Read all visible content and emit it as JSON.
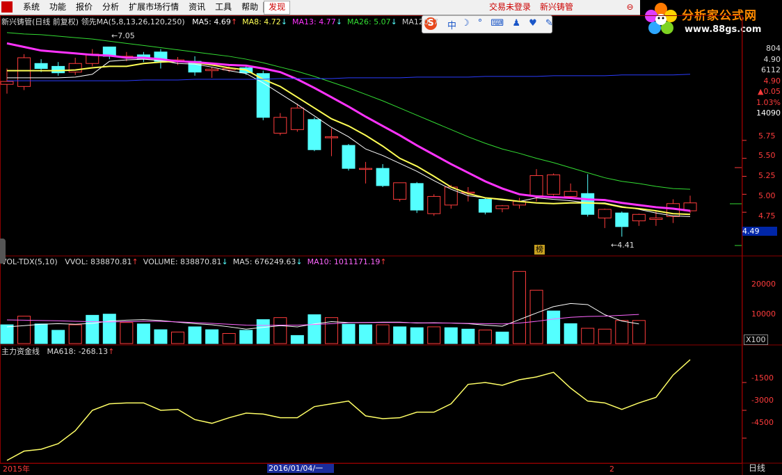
{
  "menu": {
    "items": [
      "系统",
      "功能",
      "报价",
      "分析",
      "扩展市场行情",
      "资讯",
      "工具",
      "帮助"
    ],
    "discover": "发现",
    "login_status": "交易未登录",
    "stock_name": "新兴铸管",
    "window_control": "⊖"
  },
  "brand": {
    "title": "分析家公式网",
    "url": "www.88gs.com"
  },
  "ime": {
    "logo": "S",
    "mode": "中"
  },
  "colors": {
    "up": "#ff3c3c",
    "down": "#54ffff",
    "ma5": "#ffffff",
    "ma8": "#ffff55",
    "ma13": "#ff33ff",
    "ma26": "#33dd33",
    "ma120": "#2b3cff",
    "grid": "#8b0000",
    "zhuli": "#ffff66"
  },
  "main_panel": {
    "title": "新兴铸管(日线 前复权) 领先MA(5,8,13,26,120,250)",
    "ma_items": [
      {
        "label": "MA5: 4.69",
        "arrow": "↑",
        "color": "#ffffff",
        "arrow_color": "#ff3c3c"
      },
      {
        "label": "MA8: 4.72",
        "arrow": "↓",
        "color": "#ffff55",
        "arrow_color": "#54ffff"
      },
      {
        "label": "MA13: 4.77",
        "arrow": "↓",
        "color": "#ff33ff",
        "arrow_color": "#54ffff"
      },
      {
        "label": "MA26: 5.07",
        "arrow": "↓",
        "color": "#33dd33",
        "arrow_color": "#54ffff"
      },
      {
        "label": "MA120: 7",
        "arrow": "",
        "color": "#cccccc",
        "arrow_color": "#cccccc"
      }
    ],
    "high_label": "7.05",
    "low_label": "4.41",
    "bang_badge": "榜",
    "right_info": [
      "804",
      "4.90",
      "6112",
      "4.90",
      "▲0.05",
      "1.03%",
      "14090"
    ],
    "price_ticks": [
      "5.75",
      "5.50",
      "5.25",
      "5.00",
      "4.75"
    ],
    "current_price": "4.49"
  },
  "volume_panel": {
    "title": "VOL-TDX(5,10)",
    "items": [
      {
        "label": "VVOL: 838870.81",
        "arrow": "↑",
        "color": "#dddddd",
        "arrow_color": "#ff3c3c"
      },
      {
        "label": "VOLUME: 838870.81",
        "arrow": "↓",
        "color": "#dddddd",
        "arrow_color": "#54ffff"
      },
      {
        "label": "MA5: 676249.63",
        "arrow": "↓",
        "color": "#dddddd",
        "arrow_color": "#54ffff"
      },
      {
        "label": "MA10: 1011171.19",
        "arrow": "↑",
        "color": "#ff66ff",
        "arrow_color": "#ff3c3c"
      }
    ],
    "ticks": [
      "20000",
      "10000"
    ],
    "unit": "X100"
  },
  "zhuli_panel": {
    "title": "主力资金线",
    "items": [
      {
        "label": "MA618: -268.13",
        "arrow": "↑",
        "color": "#dddddd",
        "arrow_color": "#ff3c3c"
      }
    ],
    "ticks": [
      "-1500",
      "-3000",
      "-4500"
    ]
  },
  "bottom_axis": {
    "year_label": "2015年",
    "cursor_date": "2016/01/04/一",
    "month_mark": "2",
    "period": "日线"
  },
  "chart_data": [
    {
      "type": "candlestick",
      "title": "新兴铸管(日线 前复权)",
      "ylim": [
        4.2,
        7.2
      ],
      "y_ticks": [
        4.75,
        5.0,
        5.25,
        5.5,
        5.75
      ],
      "candles": [
        {
          "o": 6.53,
          "c": 6.57,
          "h": 6.75,
          "l": 6.4
        },
        {
          "o": 6.5,
          "c": 6.9,
          "h": 6.95,
          "l": 6.45
        },
        {
          "o": 6.82,
          "c": 6.75,
          "h": 6.88,
          "l": 6.7
        },
        {
          "o": 6.78,
          "c": 6.69,
          "h": 6.84,
          "l": 6.65
        },
        {
          "o": 6.7,
          "c": 6.82,
          "h": 6.9,
          "l": 6.66
        },
        {
          "o": 6.82,
          "c": 6.95,
          "h": 7.02,
          "l": 6.78
        },
        {
          "o": 7.05,
          "c": 6.92,
          "h": 7.05,
          "l": 6.88
        },
        {
          "o": 6.92,
          "c": 6.92,
          "h": 6.98,
          "l": 6.85
        },
        {
          "o": 6.94,
          "c": 6.88,
          "h": 6.98,
          "l": 6.84
        },
        {
          "o": 6.98,
          "c": 6.85,
          "h": 7.02,
          "l": 6.75
        },
        {
          "o": 6.87,
          "c": 6.87,
          "h": 6.91,
          "l": 6.8
        },
        {
          "o": 6.85,
          "c": 6.7,
          "h": 6.92,
          "l": 6.65
        },
        {
          "o": 6.72,
          "c": 6.74,
          "h": 6.77,
          "l": 6.62
        },
        {
          "o": 6.73,
          "c": 6.75,
          "h": 6.78,
          "l": 6.7
        },
        {
          "o": 6.76,
          "c": 6.69,
          "h": 6.8,
          "l": 6.66
        },
        {
          "o": 6.68,
          "c": 6.07,
          "h": 6.72,
          "l": 6.03
        },
        {
          "o": 5.85,
          "c": 6.07,
          "h": 6.13,
          "l": 5.82
        },
        {
          "o": 5.9,
          "c": 6.2,
          "h": 6.26,
          "l": 5.87
        },
        {
          "o": 6.04,
          "c": 5.62,
          "h": 6.07,
          "l": 5.6
        },
        {
          "o": 5.8,
          "c": 5.8,
          "h": 5.92,
          "l": 5.53
        },
        {
          "o": 5.68,
          "c": 5.36,
          "h": 5.7,
          "l": 5.33
        },
        {
          "o": 5.36,
          "c": 5.36,
          "h": 5.45,
          "l": 5.15
        },
        {
          "o": 5.36,
          "c": 5.12,
          "h": 5.42,
          "l": 5.1
        },
        {
          "o": 4.93,
          "c": 5.16,
          "h": 5.16,
          "l": 4.9
        },
        {
          "o": 5.15,
          "c": 4.78,
          "h": 5.17,
          "l": 4.74
        },
        {
          "o": 4.73,
          "c": 4.97,
          "h": 5.0,
          "l": 4.7
        },
        {
          "o": 4.85,
          "c": 5.1,
          "h": 5.13,
          "l": 4.8
        },
        {
          "o": 5.03,
          "c": 5.03,
          "h": 5.1,
          "l": 4.9
        },
        {
          "o": 4.93,
          "c": 4.75,
          "h": 4.95,
          "l": 4.72
        },
        {
          "o": 4.8,
          "c": 4.84,
          "h": 4.85,
          "l": 4.75
        },
        {
          "o": 4.85,
          "c": 4.9,
          "h": 4.95,
          "l": 4.8
        },
        {
          "o": 4.98,
          "c": 5.26,
          "h": 5.35,
          "l": 4.9
        },
        {
          "o": 5.0,
          "c": 5.27,
          "h": 5.29,
          "l": 4.98
        },
        {
          "o": 4.97,
          "c": 5.04,
          "h": 5.15,
          "l": 4.95
        },
        {
          "o": 5.01,
          "c": 4.72,
          "h": 5.28,
          "l": 4.69
        },
        {
          "o": 4.67,
          "c": 4.79,
          "h": 4.8,
          "l": 4.53
        },
        {
          "o": 4.74,
          "c": 4.55,
          "h": 4.76,
          "l": 4.41
        },
        {
          "o": 4.63,
          "c": 4.72,
          "h": 4.73,
          "l": 4.56
        },
        {
          "o": 4.65,
          "c": 4.67,
          "h": 4.77,
          "l": 4.56
        },
        {
          "o": 4.69,
          "c": 4.87,
          "h": 4.93,
          "l": 4.6
        },
        {
          "o": 4.77,
          "c": 4.88,
          "h": 4.98,
          "l": 4.74
        }
      ],
      "series": [
        {
          "name": "MA5",
          "values": [
            6.62,
            6.62,
            6.62,
            6.62,
            6.63,
            6.67,
            6.85,
            6.87,
            6.88,
            6.86,
            6.82,
            6.81,
            6.77,
            6.72,
            6.68,
            6.55,
            6.4,
            6.25,
            6.09,
            5.93,
            5.8,
            5.63,
            5.54,
            5.43,
            5.32,
            5.19,
            5.07,
            4.98,
            4.95,
            4.92,
            4.9,
            4.95,
            4.93,
            4.91,
            4.88,
            4.88,
            4.83,
            4.79,
            4.74,
            4.7,
            4.69
          ]
        },
        {
          "name": "MA8",
          "values": [
            6.72,
            6.72,
            6.72,
            6.72,
            6.73,
            6.76,
            6.78,
            6.78,
            6.82,
            6.84,
            6.85,
            6.83,
            6.8,
            6.76,
            6.73,
            6.6,
            6.5,
            6.35,
            6.2,
            6.05,
            5.95,
            5.82,
            5.67,
            5.5,
            5.39,
            5.25,
            5.1,
            5.01,
            4.95,
            4.93,
            4.9,
            4.88,
            4.87,
            4.88,
            4.88,
            4.87,
            4.82,
            4.8,
            4.77,
            4.73,
            4.72
          ]
        },
        {
          "name": "MA13",
          "values": [
            7.1,
            7.05,
            7.0,
            6.98,
            6.96,
            6.94,
            6.93,
            6.9,
            6.9,
            6.88,
            6.85,
            6.84,
            6.82,
            6.8,
            6.79,
            6.75,
            6.7,
            6.6,
            6.48,
            6.35,
            6.22,
            6.08,
            5.95,
            5.82,
            5.68,
            5.55,
            5.42,
            5.3,
            5.18,
            5.08,
            5.0,
            4.97,
            4.96,
            4.95,
            4.93,
            4.92,
            4.88,
            4.85,
            4.82,
            4.8,
            4.77
          ]
        },
        {
          "name": "MA26",
          "values": [
            7.25,
            7.23,
            7.22,
            7.2,
            7.18,
            7.16,
            7.13,
            7.1,
            7.07,
            7.04,
            7.01,
            6.98,
            6.95,
            6.92,
            6.88,
            6.83,
            6.77,
            6.71,
            6.64,
            6.56,
            6.48,
            6.39,
            6.3,
            6.2,
            6.1,
            6.0,
            5.9,
            5.8,
            5.71,
            5.63,
            5.57,
            5.5,
            5.44,
            5.37,
            5.3,
            5.23,
            5.18,
            5.15,
            5.11,
            5.08,
            5.07
          ]
        },
        {
          "name": "MA120",
          "values": [
            6.58,
            6.58,
            6.58,
            6.58,
            6.58,
            6.58,
            6.58,
            6.58,
            6.59,
            6.59,
            6.59,
            6.6,
            6.6,
            6.6,
            6.6,
            6.6,
            6.61,
            6.61,
            6.61,
            6.61,
            6.62,
            6.62,
            6.62,
            6.62,
            6.63,
            6.63,
            6.63,
            6.63,
            6.64,
            6.64,
            6.64,
            6.64,
            6.65,
            6.65,
            6.65,
            6.65,
            6.66,
            6.66,
            6.66,
            6.66,
            6.67
          ]
        }
      ]
    },
    {
      "type": "bar",
      "title": "VOL-TDX(5,10)",
      "unit": "X100",
      "ylim": [
        0,
        27000
      ],
      "values": [
        6500,
        9500,
        6800,
        4600,
        6500,
        9800,
        10200,
        7300,
        6800,
        4800,
        4000,
        5800,
        4800,
        3500,
        4600,
        8300,
        9000,
        2800,
        10000,
        9000,
        6700,
        6500,
        6500,
        5800,
        5500,
        5800,
        5500,
        5000,
        4700,
        4000,
        25000,
        18500,
        11300,
        6900,
        5300,
        5000,
        8000,
        8000
      ],
      "series": [
        {
          "name": "MA5",
          "values": [
            5800,
            6200,
            6700,
            6900,
            6700,
            7000,
            7800,
            8100,
            8300,
            8000,
            7400,
            6900,
            6500,
            5800,
            5000,
            5600,
            6200,
            5800,
            6800,
            7600,
            7300,
            7300,
            7400,
            7400,
            7100,
            7200,
            7100,
            6900,
            6400,
            6000,
            8300,
            10600,
            12800,
            13900,
            13500,
            10000,
            7800,
            6800
          ]
        },
        {
          "name": "MA10",
          "values": [
            8200,
            8100,
            8000,
            7900,
            7700,
            7600,
            7500,
            7600,
            7700,
            7700,
            7500,
            7300,
            7000,
            6700,
            6400,
            6300,
            6400,
            6400,
            6600,
            6900,
            7200,
            7300,
            7300,
            7300,
            7200,
            7100,
            7100,
            7000,
            6900,
            6800,
            7100,
            7700,
            8500,
            9100,
            9400,
            9500,
            9800,
            10100
          ]
        }
      ]
    },
    {
      "type": "line",
      "title": "主力资金线",
      "ylim": [
        -5700,
        0
      ],
      "series": [
        {
          "name": "MA618",
          "values": [
            -5700,
            -5200,
            -5100,
            -4800,
            -4100,
            -3000,
            -2650,
            -2600,
            -2600,
            -3000,
            -2950,
            -3500,
            -3700,
            -3400,
            -3150,
            -3200,
            -3400,
            -3400,
            -2800,
            -2650,
            -2500,
            -3300,
            -3450,
            -3400,
            -3100,
            -3100,
            -2650,
            -1600,
            -1500,
            -1650,
            -1350,
            -1200,
            -950,
            -1800,
            -2500,
            -2600,
            -2950,
            -2600,
            -2300,
            -1100,
            -268.13
          ]
        }
      ]
    }
  ]
}
